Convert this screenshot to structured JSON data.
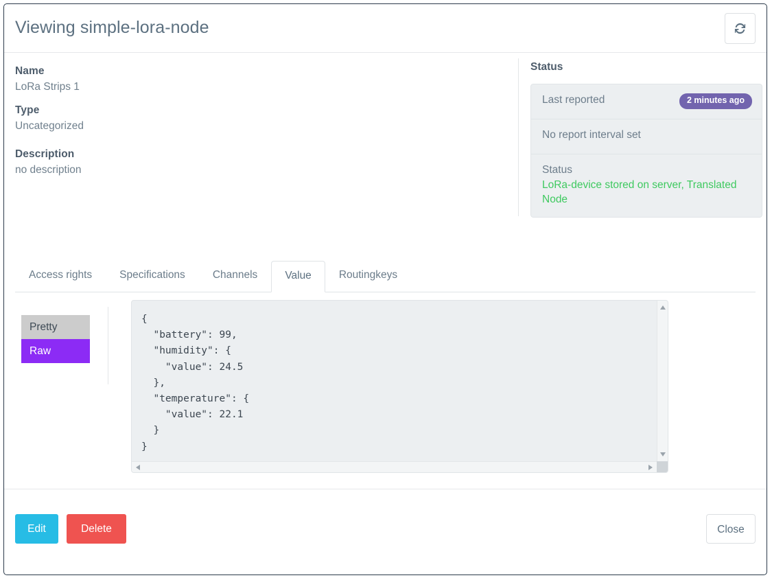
{
  "header": {
    "title": "Viewing simple-lora-node",
    "refresh_icon": "refresh-icon"
  },
  "details": {
    "name_label": "Name",
    "name_value": "LoRa Strips 1",
    "type_label": "Type",
    "type_value": "Uncategorized",
    "description_label": "Description",
    "description_value": "no description"
  },
  "status_panel": {
    "heading": "Status",
    "last_reported_label": "Last reported",
    "last_reported_badge": "2 minutes ago",
    "badge_color": "#7264ae",
    "report_interval_text": "No report interval set",
    "status_label": "Status",
    "status_value": "LoRa-device stored on server, Translated Node",
    "status_value_color": "#3ec95f"
  },
  "tabs": [
    {
      "label": "Access rights",
      "active": false
    },
    {
      "label": "Specifications",
      "active": false
    },
    {
      "label": "Channels",
      "active": false
    },
    {
      "label": "Value",
      "active": true
    },
    {
      "label": "Routingkeys",
      "active": false
    }
  ],
  "value_pane": {
    "pretty_label": "Pretty",
    "raw_label": "Raw",
    "pretty_color": "#cccccc",
    "raw_color": "#8c2bf5",
    "json_text": "{\n  \"battery\": 99,\n  \"humidity\": {\n    \"value\": 24.5\n  },\n  \"temperature\": {\n    \"value\": 22.1\n  }\n}",
    "json_values": {
      "battery": 99,
      "humidity": {
        "value": 24.5
      },
      "temperature": {
        "value": 22.1
      }
    }
  },
  "footer": {
    "edit_label": "Edit",
    "delete_label": "Delete",
    "close_label": "Close",
    "edit_color": "#27bce5",
    "delete_color": "#ef5350"
  }
}
